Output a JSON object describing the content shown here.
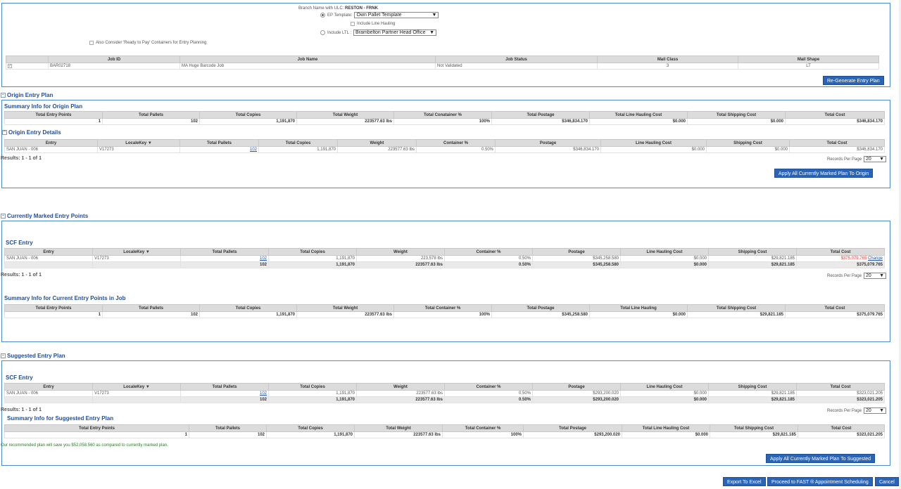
{
  "top": {
    "branch_label": "Branch Name with ULC:",
    "branch_value": "RESTON - FRNK",
    "ep_template_label": "EP Template:",
    "ep_template_value": "Own Pallet Template",
    "include_line_hauling": "Include Line Hauling",
    "include_ltl_label": "Include LTL :",
    "ltl_value": "Brambelton Partner Head Office",
    "also_consider": "Also Consider 'Ready to Pay' Containers for Entry Planning",
    "job_headers": [
      "Job ID",
      "Job Name",
      "Job Status",
      "Mail Class",
      "Mail Shape"
    ],
    "job_row": [
      "BAR02718",
      "MA Huge Barcode Job",
      "Not Validated",
      "3",
      "LT"
    ],
    "regenerate": "Re-Generate Entry Plan"
  },
  "origin": {
    "title": "Origin Entry Plan",
    "summary_title": "Summary Info for Origin Plan",
    "summary_headers": [
      "Total Entry Points",
      "Total Pallets",
      "Total Copies",
      "Total Weight",
      "Total Conatainer %",
      "Total Postage",
      "Total Line Hauling Cost",
      "Total Shipping Cost",
      "Total Cost"
    ],
    "summary_row": [
      "1",
      "102",
      "1,191,870",
      "223577.63 lbs",
      "100%",
      "$346,834.170",
      "$0.000",
      "$0.000",
      "$346,834.170"
    ],
    "details_title": "Origin Entry Details",
    "headers": [
      "Entry",
      "LocaleKey ▼",
      "Total Pallets",
      "Total Copies",
      "Weight",
      "Container %",
      "Postage",
      "Line Hauling Cost",
      "Shipping Cost",
      "Total Cost"
    ],
    "row": [
      "SAN JUAN - 006",
      "V17273",
      "102",
      "1,191,870",
      "223577.63 lbs",
      "0.50%",
      "$346,834.170",
      "$0.000",
      "$0.000",
      "$346,834.170"
    ],
    "results": "Results: 1 - 1 of 1",
    "records_per_page": "Records Per Page",
    "rpp_value": "20",
    "apply_btn": "Apply All Currently Marked Plan To Origin"
  },
  "marked": {
    "title": "Currently Marked Entry Points",
    "scf_title": "SCF Entry",
    "headers": [
      "Entry",
      "LocaleKey ▼",
      "Total Pallets",
      "Total Copies",
      "Weight",
      "Container %",
      "Postage",
      "Line Hauling Cost",
      "Shipping Cost",
      "Total Cost"
    ],
    "row": [
      "SAN JUAN - 006",
      "V17273",
      "102",
      "1,191,870",
      "223,578 lbs",
      "0.50%",
      "$345,258.580",
      "$0.000",
      "$29,821.185",
      "$375,079.765"
    ],
    "change": "Change",
    "total_row": [
      "",
      "",
      "102",
      "1,191,870",
      "223577.63 lbs",
      "0.50%",
      "$345,258.580",
      "$0.000",
      "$29,821.185",
      "$375,079.765"
    ],
    "results": "Results: 1 - 1 of 1",
    "records_per_page": "Records Per Page",
    "rpp_value": "20",
    "summary_title": "Summary Info for Current Entry Points in Job",
    "summary_headers": [
      "Total Entry Points",
      "Total Pallets",
      "Total Copies",
      "Total Weight",
      "Total Container %",
      "Total Postage",
      "Total Line Hauling",
      "Total Shipping Cost",
      "Total Cost"
    ],
    "summary_row": [
      "1",
      "102",
      "1,191,870",
      "223577.63 lbs",
      "100%",
      "$345,258.580",
      "$0.000",
      "$29,821.185",
      "$375,079.765"
    ]
  },
  "suggested": {
    "title": "Suggested Entry Plan",
    "scf_title": "SCF Entry",
    "headers": [
      "Entry",
      "LocaleKey ▼",
      "Total Pallets",
      "Total Copies",
      "Weight",
      "Container %",
      "Postage",
      "Line Hauling Cost",
      "Shipping Cost",
      "Total Cost"
    ],
    "row": [
      "SAN JUAN - 006",
      "V17273",
      "102",
      "1,191,870",
      "223577.63 lbs",
      "0.50%",
      "$293,200.020",
      "$0.000",
      "$29,821.185",
      "$323,021.205"
    ],
    "total_row": [
      "",
      "",
      "102",
      "1,191,870",
      "223577.63 lbs",
      "0.50%",
      "$293,200.020",
      "$0.000",
      "$29,821.185",
      "$323,021.205"
    ],
    "results": "Results: 1 - 1 of 1",
    "records_per_page": "Records Per Page",
    "rpp_value": "20",
    "summary_title": "Summary Info for Suggested Entry Plan",
    "summary_headers": [
      "Total Entry Points",
      "Total Pallets",
      "Total Copies",
      "Total Weight",
      "Total Container %",
      "Total Postage",
      "Total Line Hauling Cost",
      "Total Shipping Cost",
      "Total Cost"
    ],
    "summary_row": [
      "1",
      "102",
      "1,191,870",
      "223577.63 lbs",
      "100%",
      "$293,200.020",
      "$0.000",
      "$29,821.185",
      "$323,021.205"
    ],
    "note": "Our recommended plan will save you $52,058.560 as compared to currently marked plan.",
    "apply_btn": "Apply All Currently Marked Plan To Suggested"
  },
  "footer": {
    "export": "Export To Excel",
    "proceed": "Proceed to FAST ® Appointment Scheduling",
    "cancel": "Cancel"
  }
}
